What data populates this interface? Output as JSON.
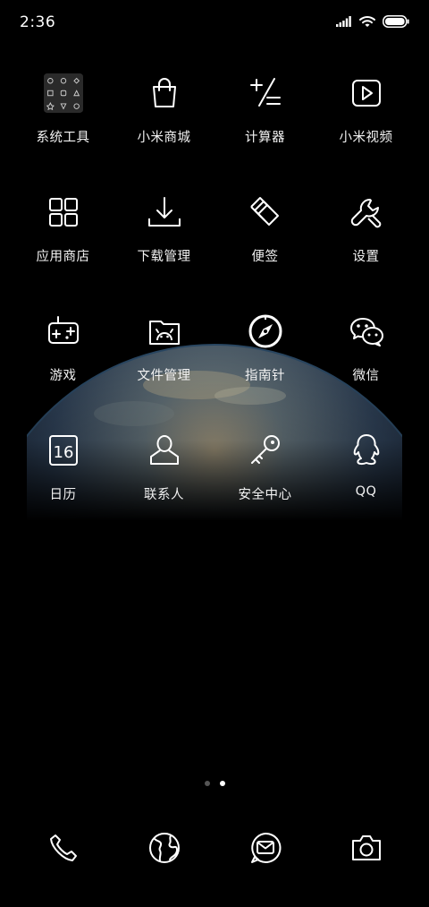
{
  "status_bar": {
    "time": "2:36"
  },
  "apps": [
    {
      "label": "系统工具",
      "icon": "folder-grid-icon"
    },
    {
      "label": "小米商城",
      "icon": "shopping-bag-icon"
    },
    {
      "label": "计算器",
      "icon": "calculator-icon"
    },
    {
      "label": "小米视频",
      "icon": "video-play-icon"
    },
    {
      "label": "应用商店",
      "icon": "app-store-icon"
    },
    {
      "label": "下载管理",
      "icon": "download-icon"
    },
    {
      "label": "便签",
      "icon": "notes-icon"
    },
    {
      "label": "设置",
      "icon": "wrench-icon"
    },
    {
      "label": "游戏",
      "icon": "gamepad-icon"
    },
    {
      "label": "文件管理",
      "icon": "file-folder-icon"
    },
    {
      "label": "指南针",
      "icon": "compass-icon"
    },
    {
      "label": "微信",
      "icon": "wechat-icon"
    },
    {
      "label": "日历",
      "icon": "calendar-icon",
      "day": "16"
    },
    {
      "label": "联系人",
      "icon": "person-icon"
    },
    {
      "label": "安全中心",
      "icon": "key-icon"
    },
    {
      "label": "QQ",
      "icon": "qq-penguin-icon"
    }
  ],
  "dock": [
    {
      "icon": "phone-icon"
    },
    {
      "icon": "globe-icon"
    },
    {
      "icon": "message-icon"
    },
    {
      "icon": "camera-icon"
    }
  ],
  "pages": {
    "count": 2,
    "current": 2
  }
}
